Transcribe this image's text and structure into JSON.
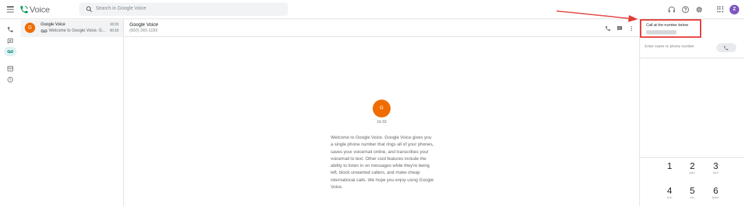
{
  "app": {
    "title": "Voice",
    "search_placeholder": "Search in Google Voice",
    "user_initial": "Z",
    "accent_color": "#0f9d58",
    "avatar_color": "#7e57c2",
    "top_icons": [
      "headset-icon",
      "help-icon",
      "settings-icon",
      "apps-icon"
    ]
  },
  "rail": {
    "items": [
      "calls-icon",
      "messages-icon",
      "voicemail-icon",
      "archive-icon",
      "spam-icon"
    ],
    "active": "voicemail-icon"
  },
  "conversations": [
    {
      "initial": "G",
      "name": "Google Voice",
      "snippet": "Welcome to Google Voice. G...",
      "time": "16:33",
      "duration": "00:18",
      "avatar_color": "#ef6c00"
    }
  ],
  "thread": {
    "name": "Google Voice",
    "number": "(650) 265-1193",
    "avatar_initial": "G",
    "time": "16:33",
    "message": "Welcome to Google Voice. Google Voice gives you a single phone number that rings all of your phones, saves your voicemail online, and transcribes your voicemail to text. Other cool features include the ability to listen in on messages while they're being left, block unwanted callers, and make cheap international calls. We hope you enjoy using Google Voice."
  },
  "dialer": {
    "call_label": "Call at the number below",
    "input_placeholder": "Enter name or phone number",
    "keys": [
      {
        "digit": "1",
        "letters": ""
      },
      {
        "digit": "2",
        "letters": "ABC"
      },
      {
        "digit": "3",
        "letters": "DEF"
      },
      {
        "digit": "4",
        "letters": "GHI"
      },
      {
        "digit": "5",
        "letters": "JKL"
      },
      {
        "digit": "6",
        "letters": "MNO"
      }
    ],
    "highlight_color": "#e53935"
  }
}
